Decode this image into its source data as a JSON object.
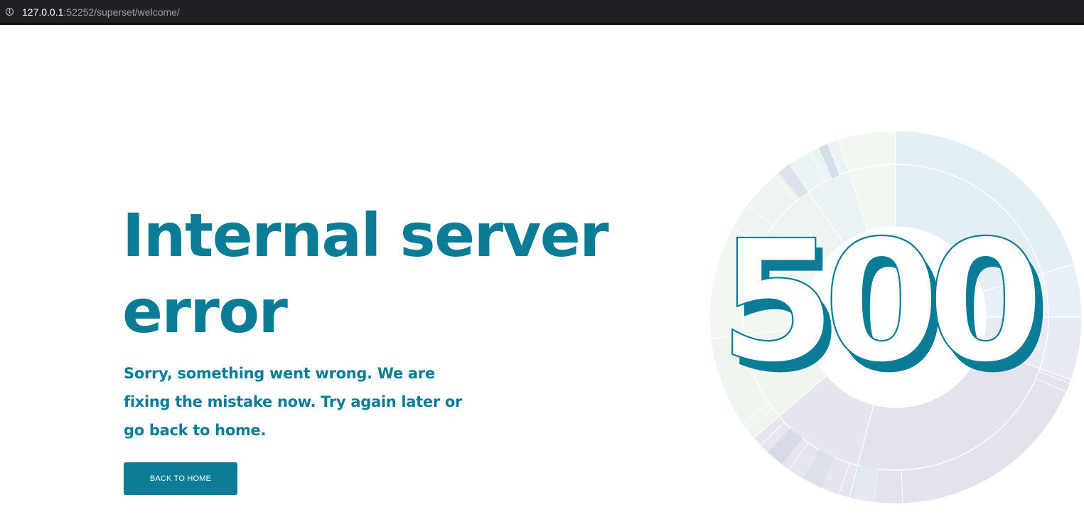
{
  "browser": {
    "url_host": "127.0.0.1",
    "url_path": ":52252/superset/welcome/"
  },
  "error": {
    "title": "Internal server error",
    "message": "Sorry, something went wrong. We are fixing the mistake now. Try again later or go back to home.",
    "code": "500",
    "back_button_label": "BACK TO HOME"
  },
  "colors": {
    "accent": "#0B7C96",
    "browser_bar": "#202124",
    "sunburst_blue": "#E3EFF5",
    "sunburst_green": "#EEF7EE",
    "sunburst_grey": "#E2E3EC"
  },
  "icons": {
    "address_info": "info-icon",
    "illustration": "sunburst-chart-graphic"
  }
}
